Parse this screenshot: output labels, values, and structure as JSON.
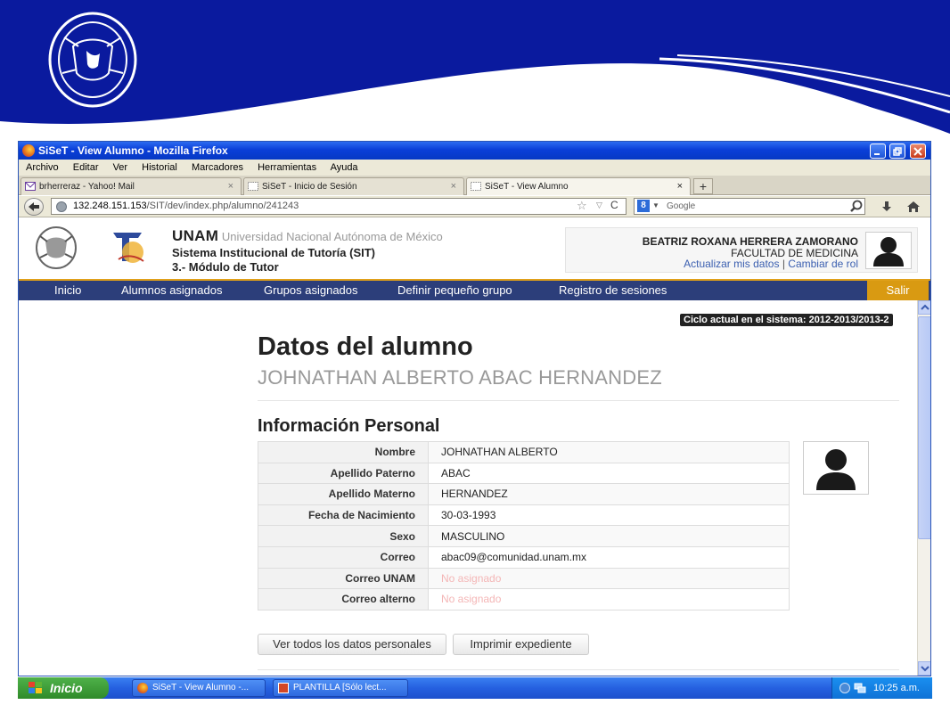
{
  "window": {
    "title": "SiSeT - View Alumno - Mozilla Firefox"
  },
  "menu": [
    "Archivo",
    "Editar",
    "Ver",
    "Historial",
    "Marcadores",
    "Herramientas",
    "Ayuda"
  ],
  "tabs": [
    {
      "label": "brherreraz - Yahoo! Mail",
      "close": "×"
    },
    {
      "label": "SiSeT - Inicio de Sesión",
      "close": "×"
    },
    {
      "label": "SiSeT - View Alumno",
      "close": "×"
    }
  ],
  "new_tab_label": "+",
  "address": {
    "host": "132.248.151.153",
    "path": "/SIT/dev/index.php/alumno/241243"
  },
  "search": {
    "placeholder": "Google"
  },
  "site": {
    "brand_short": "UNAM",
    "brand_long": "Universidad Nacional Autónoma de México",
    "system_name": "Sistema Institucional de Tutoría (SIT)",
    "module": "3.- Módulo de Tutor"
  },
  "user": {
    "name": "BEATRIZ ROXANA HERRERA ZAMORANO",
    "faculty": "FACULTAD DE MEDICINA",
    "link_update": "Actualizar mis datos",
    "separator": "|",
    "link_role": "Cambiar de rol"
  },
  "nav": {
    "items": [
      "Inicio",
      "Alumnos asignados",
      "Grupos asignados",
      "Definir pequeño grupo",
      "Registro de sesiones"
    ],
    "exit": "Salir"
  },
  "cycle_badge": "Ciclo actual en el sistema: 2012-2013/2013-2",
  "page": {
    "title": "Datos del alumno",
    "student_name": "JOHNATHAN ALBERTO ABAC HERNANDEZ",
    "section_title": "Información Personal"
  },
  "personal_info": [
    {
      "label": "Nombre",
      "value": "JOHNATHAN ALBERTO",
      "missing": false
    },
    {
      "label": "Apellido Paterno",
      "value": "ABAC",
      "missing": false
    },
    {
      "label": "Apellido Materno",
      "value": "HERNANDEZ",
      "missing": false
    },
    {
      "label": "Fecha de Nacimiento",
      "value": "30-03-1993",
      "missing": false
    },
    {
      "label": "Sexo",
      "value": "MASCULINO",
      "missing": false
    },
    {
      "label": "Correo",
      "value": "abac09@comunidad.unam.mx",
      "missing": false
    },
    {
      "label": "Correo UNAM",
      "value": "No asignado",
      "missing": true
    },
    {
      "label": "Correo alterno",
      "value": "No asignado",
      "missing": true
    }
  ],
  "buttons": {
    "all_data": "Ver todos los datos personales",
    "print": "Imprimir expediente"
  },
  "taskbar": {
    "start": "Inicio",
    "tasks": [
      "SiSeT - View Alumno -...",
      "PLANTILLA [Sólo lect..."
    ],
    "clock": "10:25 a.m."
  },
  "colors": {
    "banner_blue": "#0a1a9e",
    "nav_blue": "#2c3e7a",
    "exit_gold": "#d99a12",
    "missing_pink": "#f4b6b6",
    "link_blue": "#3b5fb0"
  }
}
